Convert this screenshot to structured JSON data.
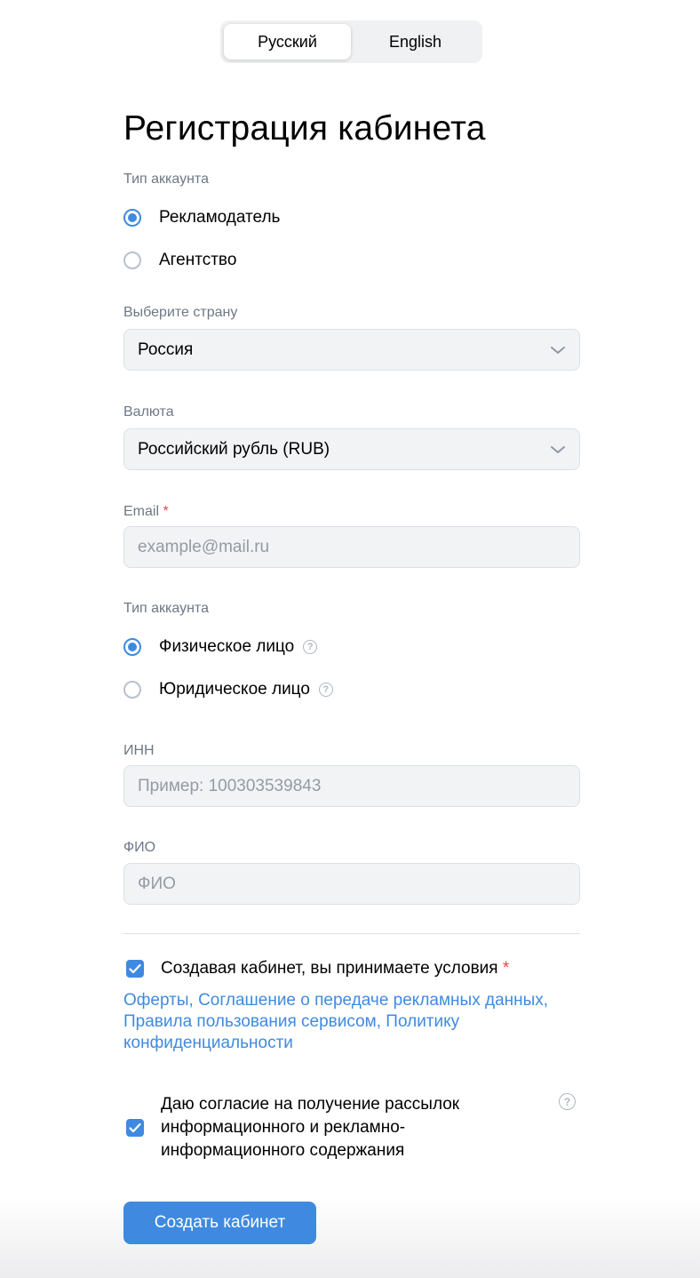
{
  "language_switch": {
    "russian": "Русский",
    "english": "English",
    "selected": "Русский"
  },
  "title": "Регистрация кабинета",
  "account_type": {
    "label": "Тип аккаунта",
    "options": [
      "Рекламодатель",
      "Агентство"
    ],
    "selected": "Рекламодатель"
  },
  "country": {
    "label": "Выберите страну",
    "value": "Россия"
  },
  "currency": {
    "label": "Валюта",
    "value": "Российский рубль (RUB)"
  },
  "email": {
    "label": "Email",
    "required_mark": "*",
    "placeholder": "example@mail.ru",
    "value": ""
  },
  "entity_type": {
    "label": "Тип аккаунта",
    "options": [
      "Физическое лицо",
      "Юридическое лицо"
    ],
    "selected": "Физическое лицо",
    "help_glyph": "?"
  },
  "inn": {
    "label": "ИНН",
    "placeholder": "Пример: 100303539843",
    "value": ""
  },
  "fio": {
    "label": "ФИО",
    "placeholder": "ФИО",
    "value": ""
  },
  "terms": {
    "text": "Создавая кабинет, вы принимаете условия",
    "required_mark": "*",
    "checked": true,
    "links": [
      "Оферты",
      "Соглашение о передаче рекламных данных",
      "Правила пользования сервисом",
      "Политику конфиденциальности"
    ],
    "separator": ","
  },
  "newsletter": {
    "line1": "Даю согласие на получение рассылок",
    "line2": "информационного и рекламно-",
    "line3": "информационного содержания",
    "checked": true
  },
  "submit_label": "Создать кабинет",
  "colors": {
    "accent": "#3f8ae0",
    "field_bg": "#f2f3f5",
    "label": "#6d7885",
    "required": "#e64646"
  },
  "icons": [
    "chevron-down-icon",
    "help-icon",
    "checkmark-icon"
  ]
}
